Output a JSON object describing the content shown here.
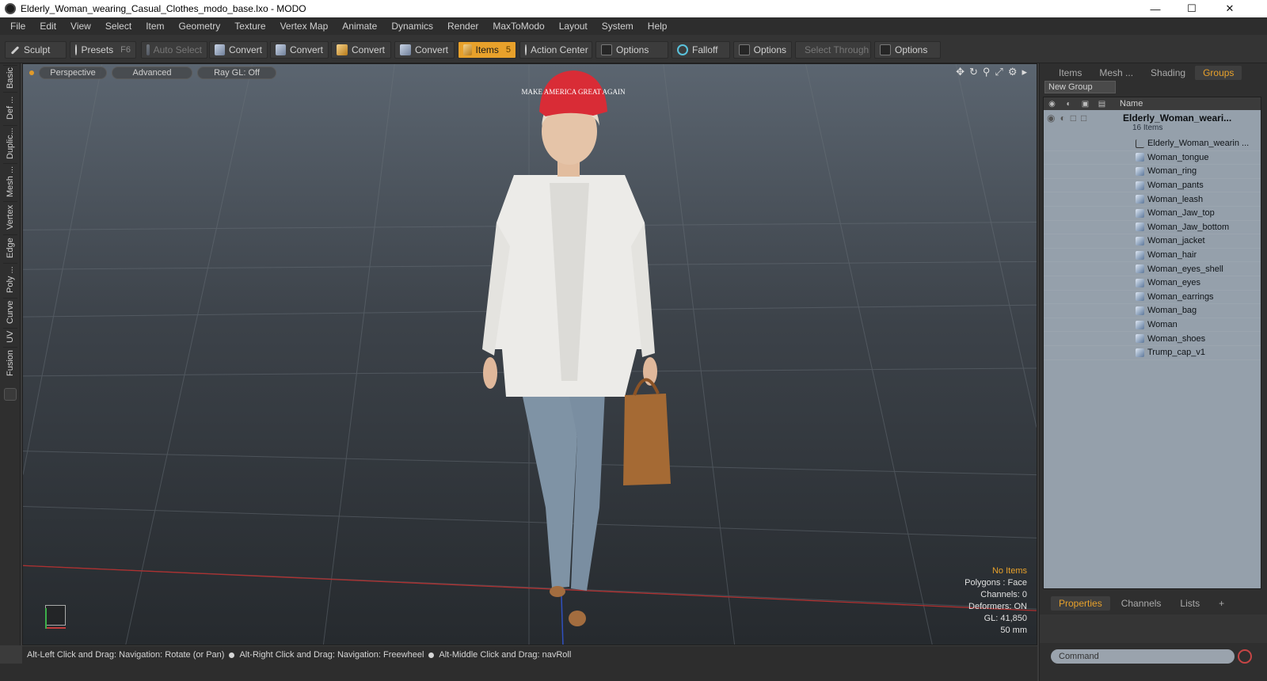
{
  "window": {
    "title": "Elderly_Woman_wearing_Casual_Clothes_modo_base.lxo - MODO"
  },
  "menu": [
    "File",
    "Edit",
    "View",
    "Select",
    "Item",
    "Geometry",
    "Texture",
    "Vertex Map",
    "Animate",
    "Dynamics",
    "Render",
    "MaxToModo",
    "Layout",
    "System",
    "Help"
  ],
  "toolbar": {
    "sculpt": "Sculpt",
    "presets": "Presets",
    "presets_key": "F6",
    "auto_select": "Auto Select",
    "convert": "Convert",
    "items": "Items",
    "items_key": "5",
    "action_center": "Action Center",
    "options": "Options",
    "falloff": "Falloff",
    "select_through": "Select Through"
  },
  "left_tabs": [
    "Basic",
    "Def ...",
    "Duplic...",
    "Mesh ...",
    "Vertex",
    "Edge",
    "Poly ...",
    "Curve",
    "UV",
    "Fusion"
  ],
  "viewport": {
    "view": "Perspective",
    "advanced": "Advanced",
    "raygl": "Ray GL: Off",
    "cap_text": "MAKE AMERICA GREAT AGAIN",
    "stats": {
      "no_items": "No Items",
      "polygons": "Polygons : Face",
      "channels": "Channels: 0",
      "deformers": "Deformers: ON",
      "gl": "GL: 41,850",
      "focal": "50 mm"
    }
  },
  "right_panel": {
    "tabs": [
      "Items",
      "Mesh ...",
      "Shading",
      "Groups"
    ],
    "new_group": "New Group",
    "name_header": "Name",
    "group": {
      "name": "Elderly_Woman_weari...",
      "count": "16 Items"
    },
    "items": [
      {
        "name": "Elderly_Woman_wearin ...",
        "type": "locator"
      },
      {
        "name": "Woman_tongue",
        "type": "mesh"
      },
      {
        "name": "Woman_ring",
        "type": "mesh"
      },
      {
        "name": "Woman_pants",
        "type": "mesh"
      },
      {
        "name": "Woman_leash",
        "type": "mesh"
      },
      {
        "name": "Woman_Jaw_top",
        "type": "mesh"
      },
      {
        "name": "Woman_Jaw_bottom",
        "type": "mesh"
      },
      {
        "name": "Woman_jacket",
        "type": "mesh"
      },
      {
        "name": "Woman_hair",
        "type": "mesh"
      },
      {
        "name": "Woman_eyes_shell",
        "type": "mesh"
      },
      {
        "name": "Woman_eyes",
        "type": "mesh"
      },
      {
        "name": "Woman_earrings",
        "type": "mesh"
      },
      {
        "name": "Woman_bag",
        "type": "mesh"
      },
      {
        "name": "Woman",
        "type": "mesh"
      },
      {
        "name": "Woman_shoes",
        "type": "mesh"
      },
      {
        "name": "Trump_cap_v1",
        "type": "mesh"
      }
    ],
    "props_tabs": [
      "Properties",
      "Channels",
      "Lists"
    ],
    "command_placeholder": "Command"
  },
  "status": {
    "hint1": "Alt-Left Click and Drag: Navigation: Rotate (or Pan)",
    "hint2": "Alt-Right Click and Drag: Navigation: Freewheel",
    "hint3": "Alt-Middle Click and Drag: navRoll"
  },
  "colors": {
    "accent": "#e8a12b",
    "tree_bg": "#95a0ab",
    "viewport_top": "#5b6570",
    "viewport_bottom": "#262a2e"
  }
}
